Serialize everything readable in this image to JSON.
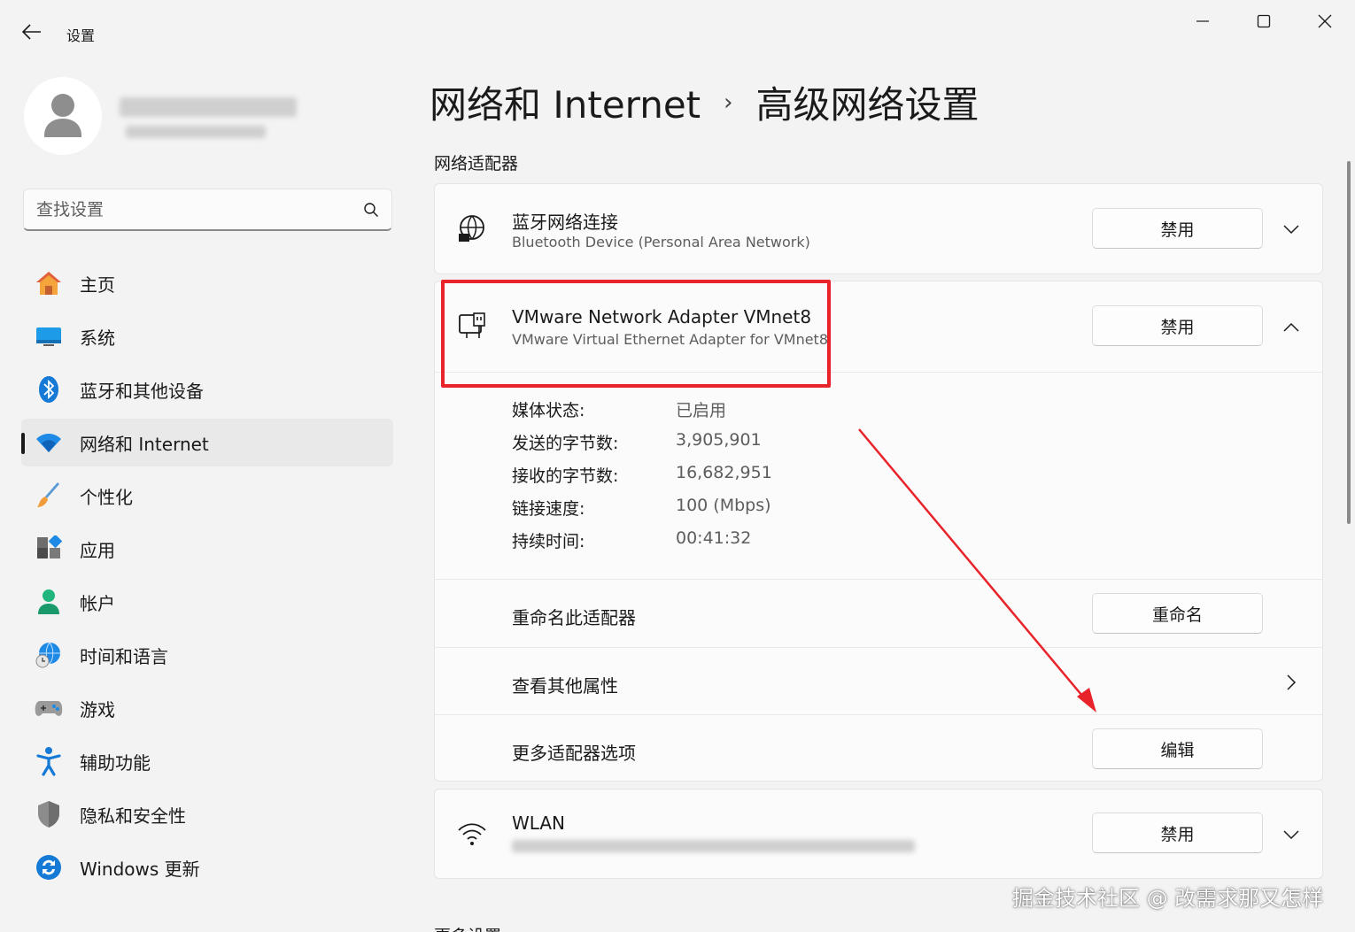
{
  "window": {
    "title": "设置",
    "back_icon": "arrow-left-icon",
    "controls": [
      "minimize-icon",
      "maximize-icon",
      "close-icon"
    ]
  },
  "search": {
    "placeholder": "查找设置",
    "icon": "search-icon"
  },
  "nav": {
    "items": [
      {
        "label": "主页",
        "icon": "home-icon"
      },
      {
        "label": "系统",
        "icon": "monitor-icon"
      },
      {
        "label": "蓝牙和其他设备",
        "icon": "bluetooth-icon"
      },
      {
        "label": "网络和 Internet",
        "icon": "wifi-icon",
        "active": true
      },
      {
        "label": "个性化",
        "icon": "brush-icon"
      },
      {
        "label": "应用",
        "icon": "apps-icon"
      },
      {
        "label": "帐户",
        "icon": "person-icon"
      },
      {
        "label": "时间和语言",
        "icon": "globe-clock-icon"
      },
      {
        "label": "游戏",
        "icon": "gamepad-icon"
      },
      {
        "label": "辅助功能",
        "icon": "accessibility-icon"
      },
      {
        "label": "隐私和安全性",
        "icon": "shield-icon"
      },
      {
        "label": "Windows 更新",
        "icon": "update-icon"
      }
    ]
  },
  "breadcrumb": {
    "parent": "网络和 Internet",
    "separator": "›",
    "current": "高级网络设置"
  },
  "section": {
    "title": "网络适配器",
    "next_title": "更多设置"
  },
  "adapters": {
    "bluetooth": {
      "title": "蓝牙网络连接",
      "subtitle": "Bluetooth Device (Personal Area Network)",
      "button": "禁用",
      "icon": "globe-network-icon"
    },
    "vmnet8": {
      "title": "VMware Network Adapter VMnet8",
      "subtitle": "VMware Virtual Ethernet Adapter for VMnet8",
      "button": "禁用",
      "icon": "ethernet-icon",
      "properties": [
        {
          "label": "媒体状态:",
          "value": "已启用"
        },
        {
          "label": "发送的字节数:",
          "value": "3,905,901"
        },
        {
          "label": "接收的字节数:",
          "value": "16,682,951"
        },
        {
          "label": "链接速度:",
          "value": "100 (Mbps)"
        },
        {
          "label": "持续时间:",
          "value": "00:41:32"
        }
      ],
      "rename_label": "重命名此适配器",
      "rename_button": "重命名",
      "view_props_label": "查看其他属性",
      "more_options_label": "更多适配器选项",
      "edit_button": "编辑"
    },
    "wlan": {
      "title": "WLAN",
      "button": "禁用",
      "icon": "wifi-signal-icon"
    }
  },
  "colors": {
    "highlight_red": "#e8232a",
    "accent_blue": "#0067c0"
  },
  "watermark": "掘金技术社区 @ 改需求那又怎样"
}
